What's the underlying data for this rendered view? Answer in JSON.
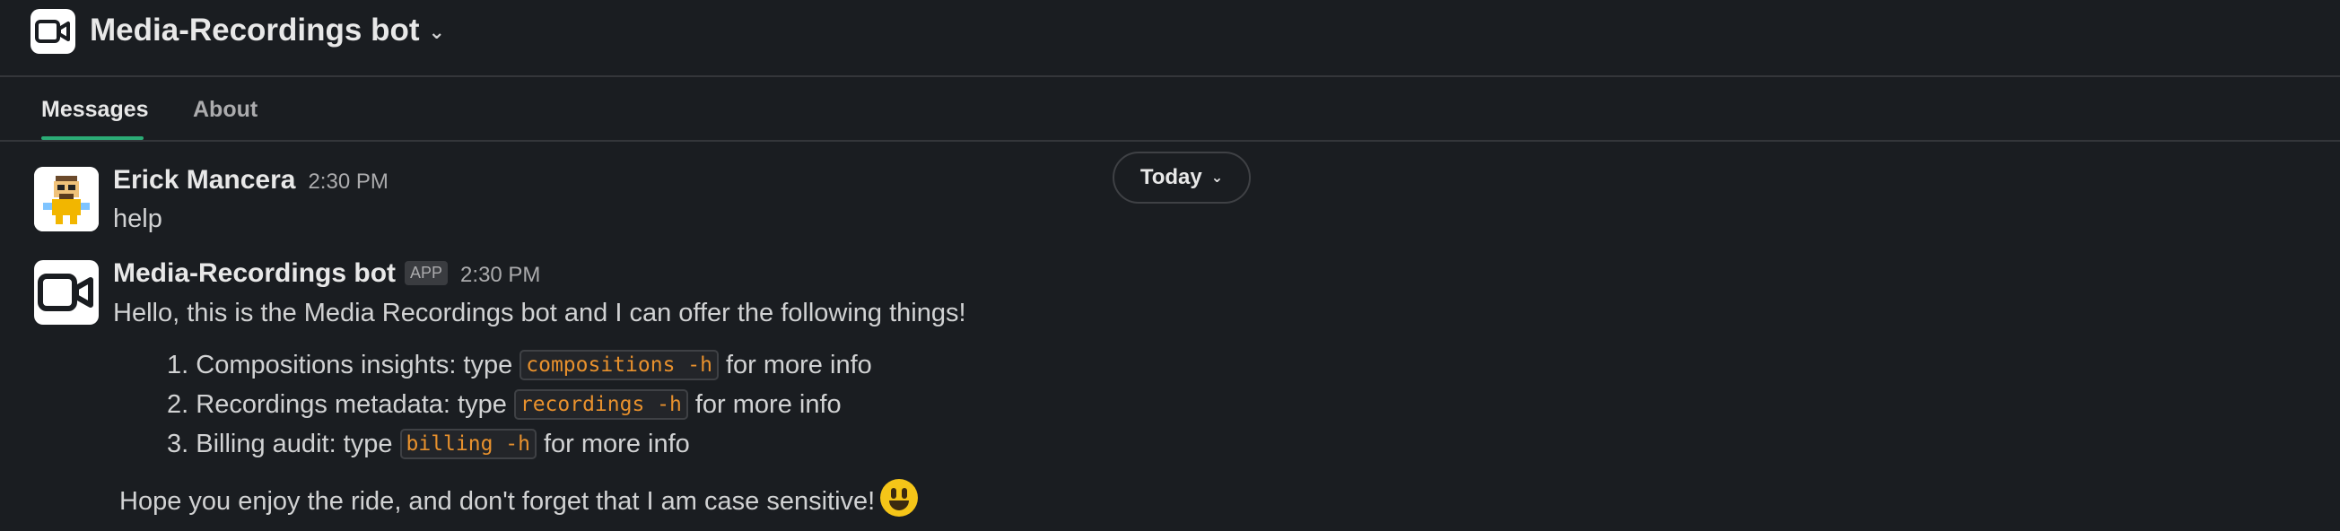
{
  "header": {
    "title": "Media-Recordings bot",
    "chevron": "⌄",
    "icon": "video-camera-icon"
  },
  "tabs": [
    {
      "label": "Messages",
      "active": true
    },
    {
      "label": "About",
      "active": false
    }
  ],
  "date_divider": {
    "label": "Today",
    "chevron": "⌄"
  },
  "messages": [
    {
      "sender": "Erick Mancera",
      "time": "2:30 PM",
      "text": "help",
      "avatar": "pixel-character-avatar"
    },
    {
      "sender": "Media-Recordings bot",
      "badge": "APP",
      "time": "2:30 PM",
      "intro": "Hello, this is the Media Recordings bot and I can offer the following things!",
      "items": [
        {
          "num": "1.",
          "before": "Compositions insights: type",
          "code": "compositions -h",
          "after": "for more info"
        },
        {
          "num": "2.",
          "before": "Recordings metadata: type",
          "code": "recordings -h",
          "after": "for more info"
        },
        {
          "num": "3.",
          "before": "Billing audit: type",
          "code": "billing -h",
          "after": "for more info"
        }
      ],
      "outro": "Hope you enjoy the ride, and don't forget that I am case sensitive!",
      "emoji": "smiley-emoji"
    }
  ],
  "colors": {
    "background": "#1a1d21",
    "accent_tab": "#2bac76",
    "code_text": "#e8912d"
  }
}
